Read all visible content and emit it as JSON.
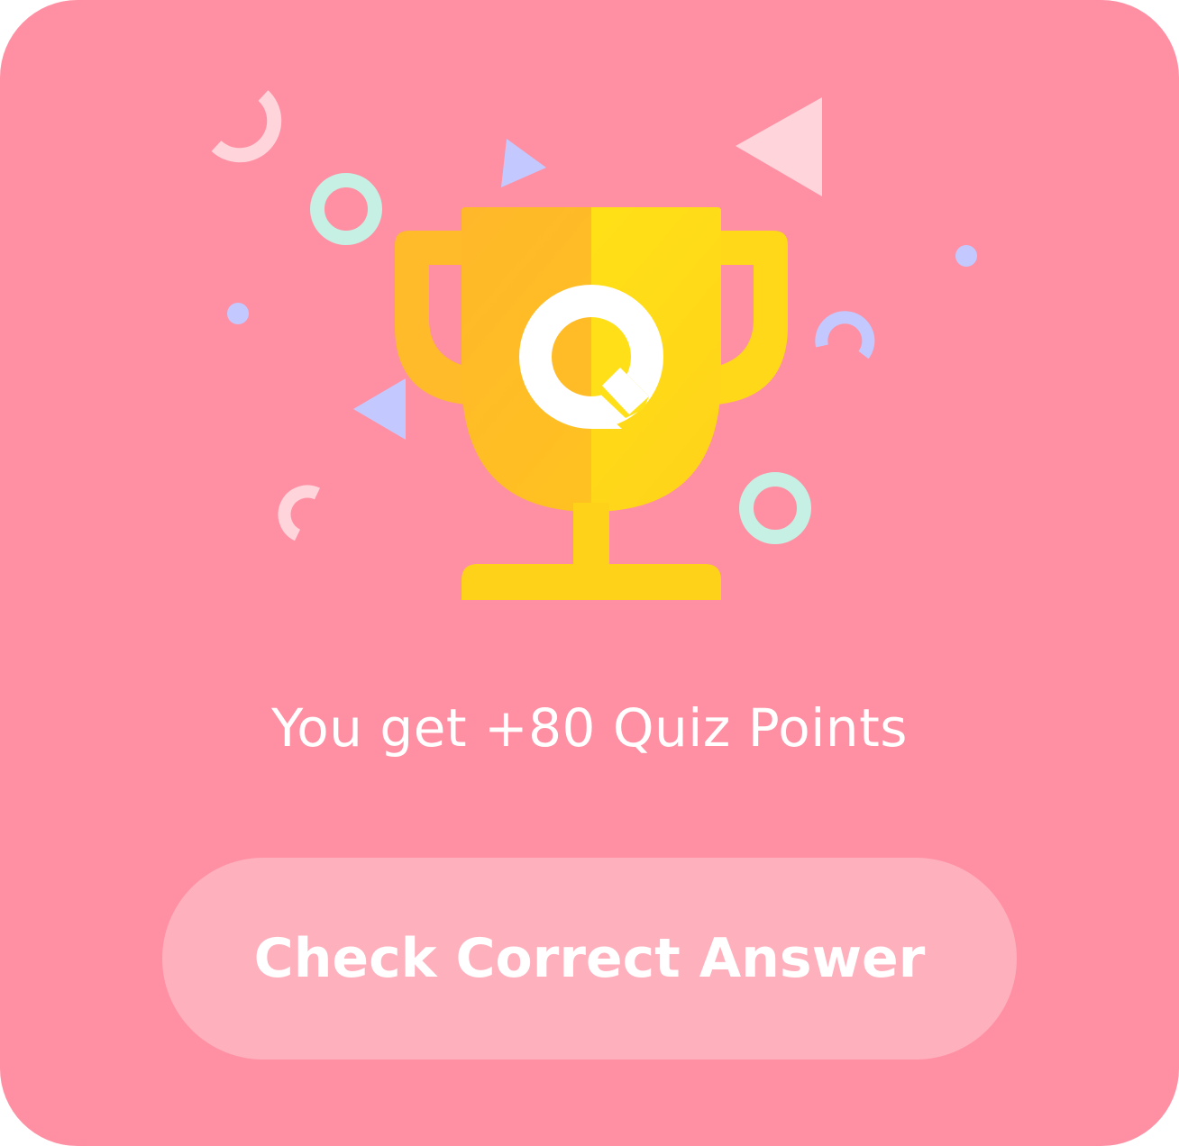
{
  "result": {
    "message": "You get +80 Quiz Points"
  },
  "actions": {
    "check_answer_label": "Check Correct Answer"
  },
  "trophy": {
    "emblem_letter": "Q",
    "icon": "trophy-icon"
  },
  "colors": {
    "background": "#ff8fa2",
    "button": "#ffb0bd",
    "trophy_gold": "#ffd21a",
    "trophy_orange": "#ffb82a",
    "confetti_pink": "#ffd4db",
    "confetti_mint": "#c6f0e4",
    "confetti_lavender": "#c3c9ff",
    "text": "#ffffff"
  }
}
